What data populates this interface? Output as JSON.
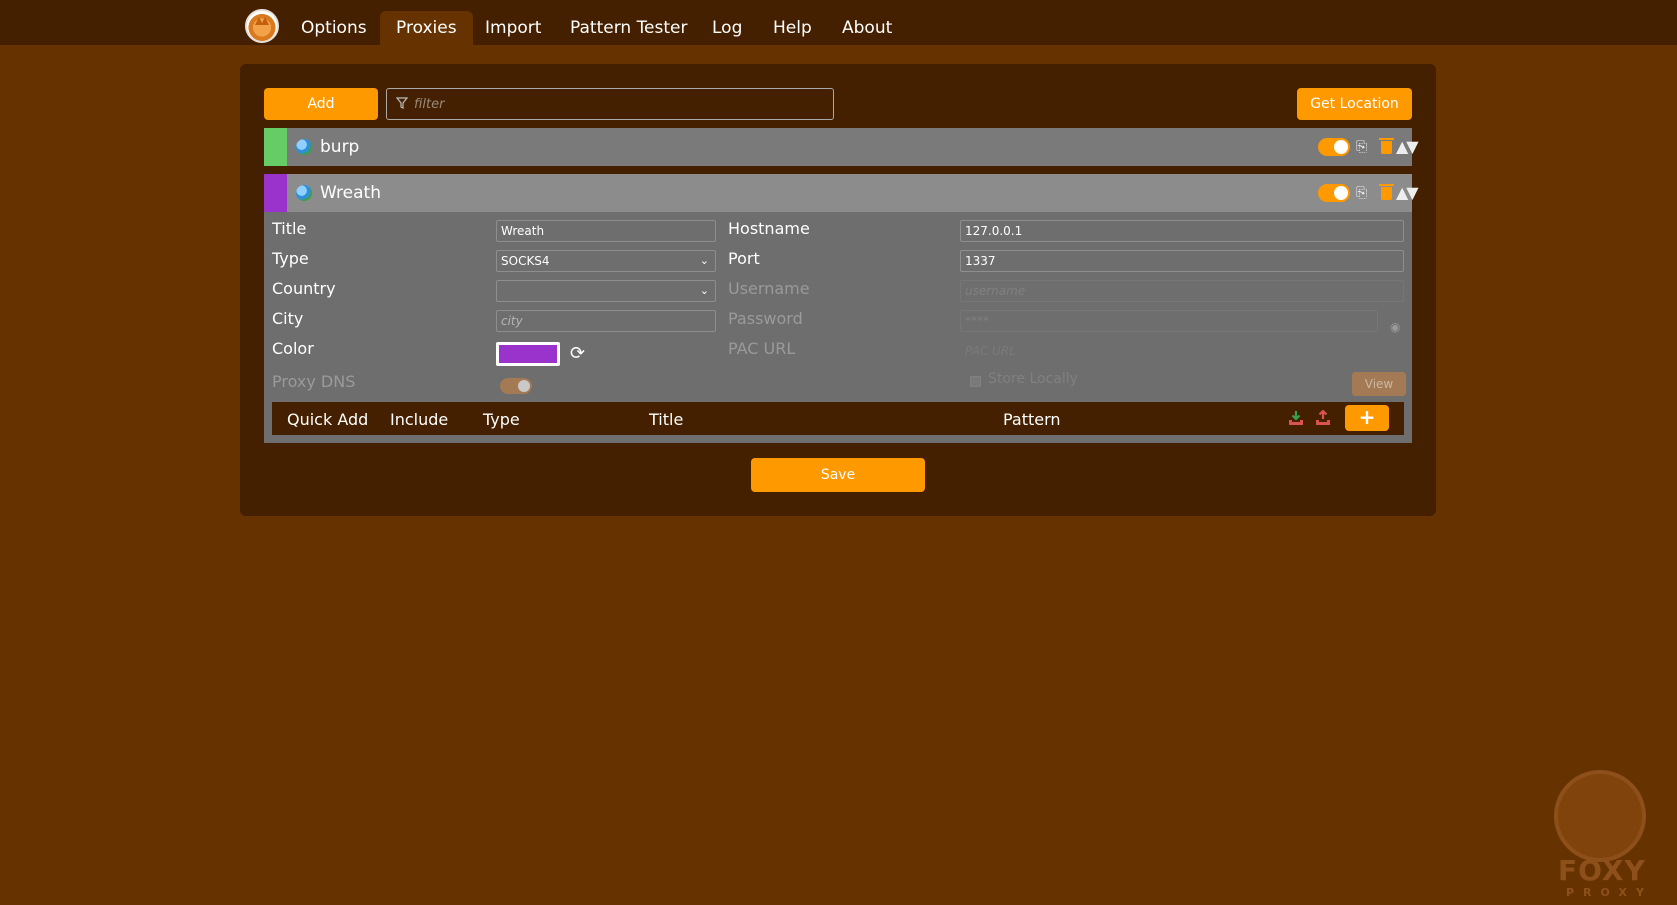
{
  "nav": {
    "tabs": [
      {
        "label": "Options"
      },
      {
        "label": "Proxies"
      },
      {
        "label": "Import"
      },
      {
        "label": "Pattern Tester"
      },
      {
        "label": "Log"
      },
      {
        "label": "Help"
      },
      {
        "label": "About"
      }
    ],
    "active_tab": "Proxies"
  },
  "toolbar": {
    "add_label": "Add",
    "filter_placeholder": "filter",
    "get_location_label": "Get Location"
  },
  "proxies": [
    {
      "title": "burp",
      "color": "#66cc66",
      "enabled": true,
      "expanded": false
    },
    {
      "title": "Wreath",
      "color": "#9933cc",
      "enabled": true,
      "expanded": true
    }
  ],
  "editor": {
    "title_label": "Title",
    "title_value": "Wreath",
    "type_label": "Type",
    "type_value": "SOCKS4",
    "country_label": "Country",
    "country_value": "",
    "city_label": "City",
    "city_placeholder": "city",
    "color_label": "Color",
    "color_value": "#9933cc",
    "proxy_dns_label": "Proxy DNS",
    "hostname_label": "Hostname",
    "hostname_value": "127.0.0.1",
    "port_label": "Port",
    "port_value": "1337",
    "username_label": "Username",
    "username_placeholder": "username",
    "password_label": "Password",
    "password_placeholder": "****",
    "pac_url_label": "PAC URL",
    "pac_url_placeholder": "PAC URL",
    "store_locally_label": "Store Locally",
    "view_label": "View"
  },
  "patterns": {
    "headers": [
      "Quick Add",
      "Include",
      "Type",
      "Title",
      "Pattern"
    ],
    "add_label": "+"
  },
  "save_label": "Save",
  "watermark": {
    "brand": "FOXY",
    "sub": "PROXY"
  }
}
